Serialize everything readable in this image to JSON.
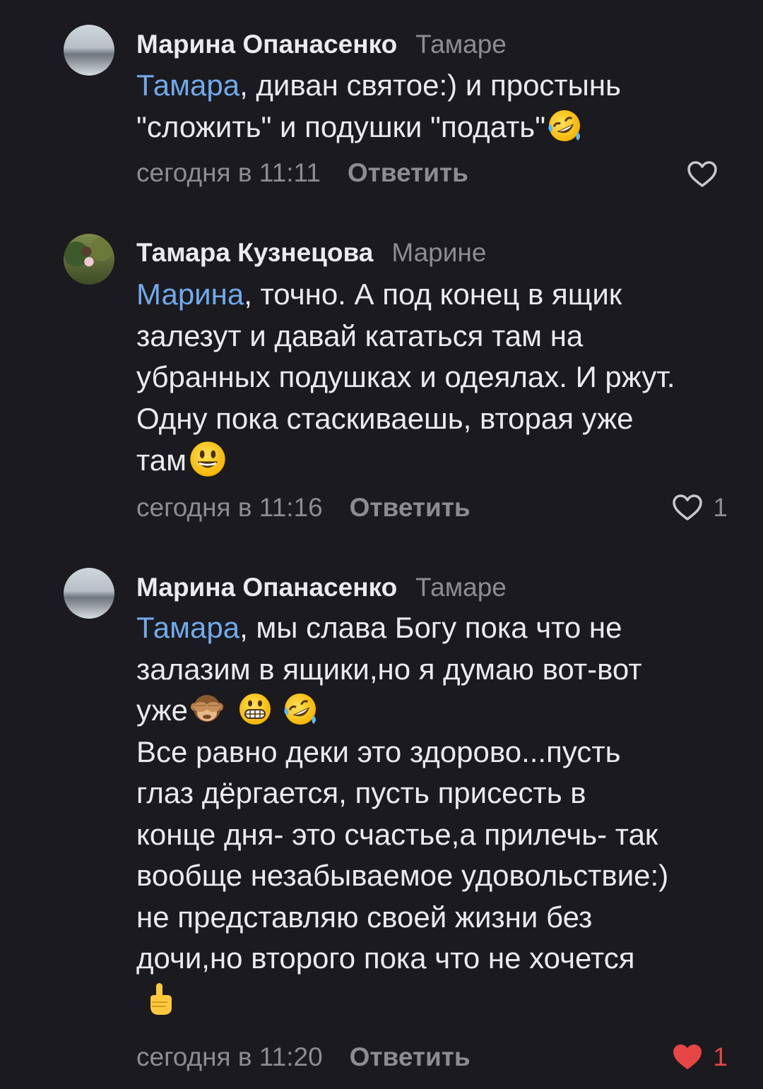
{
  "comments": [
    {
      "author": "Марина Опанасенко",
      "reply_to": "Тамаре",
      "mention": "Тамара",
      "lines": [
        ", диван святое:) и простынь",
        "\"сложить\" и подушки \"подать\""
      ],
      "time": "сегодня в 11:11",
      "reply_label": "Ответить",
      "likes": ""
    },
    {
      "author": "Тамара Кузнецова",
      "reply_to": "Марине",
      "mention": "Марина",
      "lines": [
        ", точно. А под конец в ящик",
        "залезут и давай кататься там на",
        "убранных подушках и одеялах. И ржут.",
        "Одну пока стаскиваешь, вторая уже",
        "там"
      ],
      "time": "сегодня в 11:16",
      "reply_label": "Ответить",
      "likes": "1"
    },
    {
      "author": "Марина Опанасенко",
      "reply_to": "Тамаре",
      "mention": "Тамара",
      "lines": [
        ", мы слава Богу пока что не",
        "залазим в ящики,но я думаю вот-вот",
        "уже",
        "Все равно деки это здорово...пусть",
        "глаз дёргается, пусть присесть в",
        "конце дня- это счастье,а прилечь-  так",
        "вообще незабываемое удовольствие:)",
        "не представляю своей жизни без",
        "дочи,но второго пока что не хочется"
      ],
      "time": "сегодня в 11:20",
      "reply_label": "Ответить",
      "likes": "1"
    }
  ],
  "colors": {
    "background": "#1b1a1f",
    "text": "#ebeaee",
    "secondary": "#8d8c92",
    "mention": "#71aaeb",
    "liked": "#e64646"
  }
}
